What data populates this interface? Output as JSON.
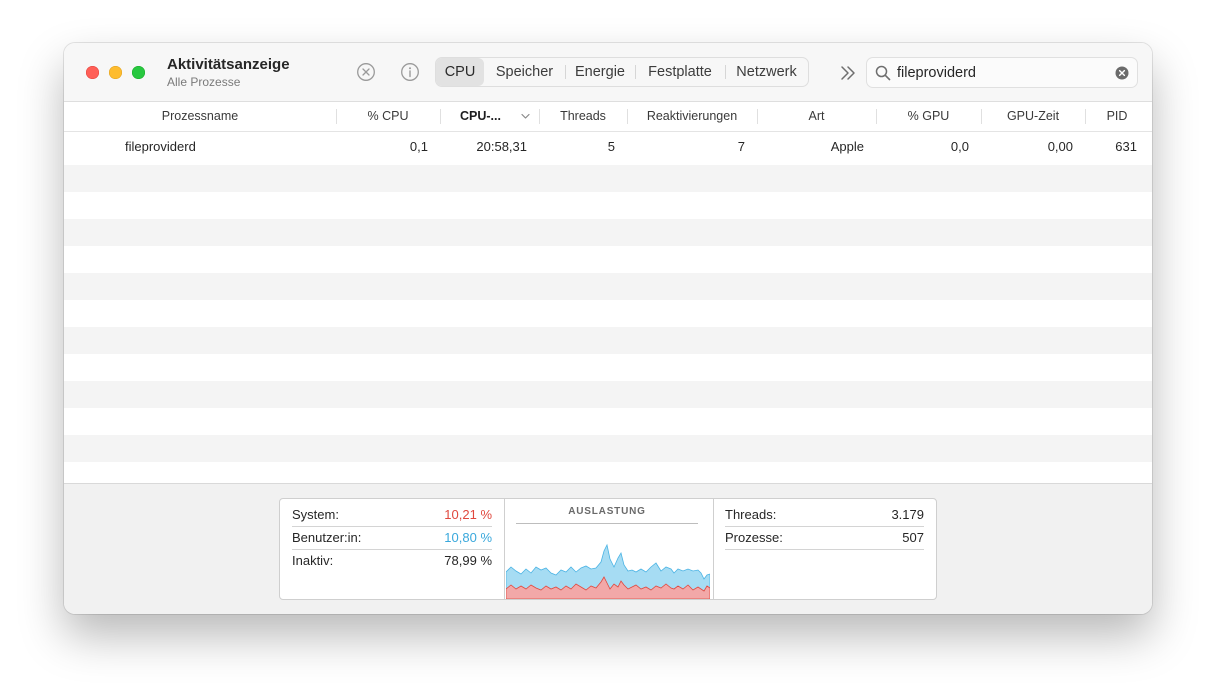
{
  "window": {
    "title": "Aktivitätsanzeige",
    "subtitle": "Alle Prozesse"
  },
  "toolbar": {
    "tabs": [
      {
        "label": "CPU",
        "active": true
      },
      {
        "label": "Speicher",
        "active": false
      },
      {
        "label": "Energie",
        "active": false
      },
      {
        "label": "Festplatte",
        "active": false
      },
      {
        "label": "Netzwerk",
        "active": false
      }
    ],
    "search": {
      "value": "fileproviderd"
    }
  },
  "table": {
    "columns": [
      "Prozessname",
      "% CPU",
      "CPU-...",
      "Threads",
      "Reaktivierungen",
      "Art",
      "% GPU",
      "GPU-Zeit",
      "PID"
    ],
    "sorted_column": "CPU-...",
    "rows": [
      {
        "name": "fileproviderd",
        "cpu": "0,1",
        "cpu_time": "20:58,31",
        "threads": "5",
        "wakeups": "7",
        "kind": "Apple",
        "gpu": "0,0",
        "gpu_time": "0,00",
        "pid": "631"
      }
    ]
  },
  "stats": {
    "system": {
      "label": "System:",
      "value": "10,21 %",
      "color": "#e0483e"
    },
    "user": {
      "label": "Benutzer:in:",
      "value": "10,80 %",
      "color": "#3aa8dc"
    },
    "idle": {
      "label": "Inaktiv:",
      "value": "78,99 %"
    },
    "graph_title": "AUSLASTUNG",
    "threads": {
      "label": "Threads:",
      "value": "3.179"
    },
    "processes": {
      "label": "Prozesse:",
      "value": "507"
    }
  }
}
